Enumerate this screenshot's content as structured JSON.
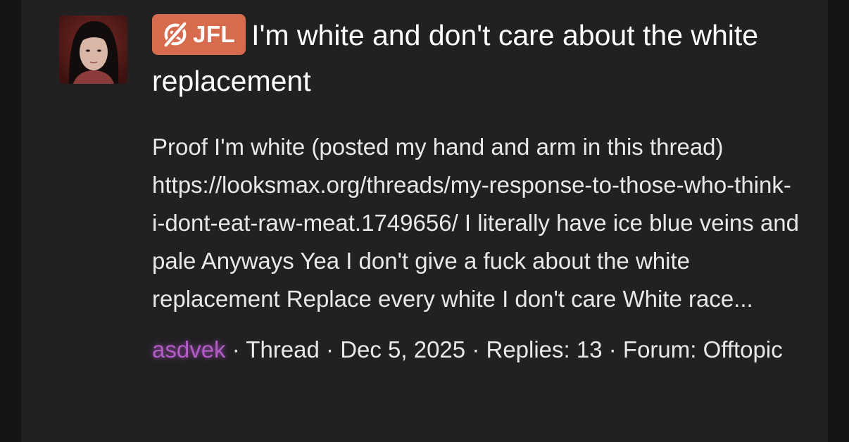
{
  "thread": {
    "prefix_label": "JFL",
    "prefix_icon": "sad-face-icon",
    "title": "I'm white and don't care about the white replacement",
    "snippet": "Proof I'm white (posted my hand and arm in this thread) https://looksmax.org/threads/my-response-to-those-who-think-i-dont-eat-raw-meat.1749656/ I literally have ice blue veins and pale Anyways Yea I don't give a fuck about the white replacement Replace every white I don't care White race...",
    "author": "asdvek",
    "separator": " · ",
    "type_label": "Thread",
    "date": "Dec 5, 2025",
    "replies_label": "Replies: 13",
    "forum_label": "Forum:",
    "forum_name": "Offtopic"
  },
  "colors": {
    "page_background": "#141414",
    "panel_background": "#212121",
    "prefix_background": "#d76b4e",
    "username": "#b25cc6",
    "text": "#e8e8e8"
  }
}
